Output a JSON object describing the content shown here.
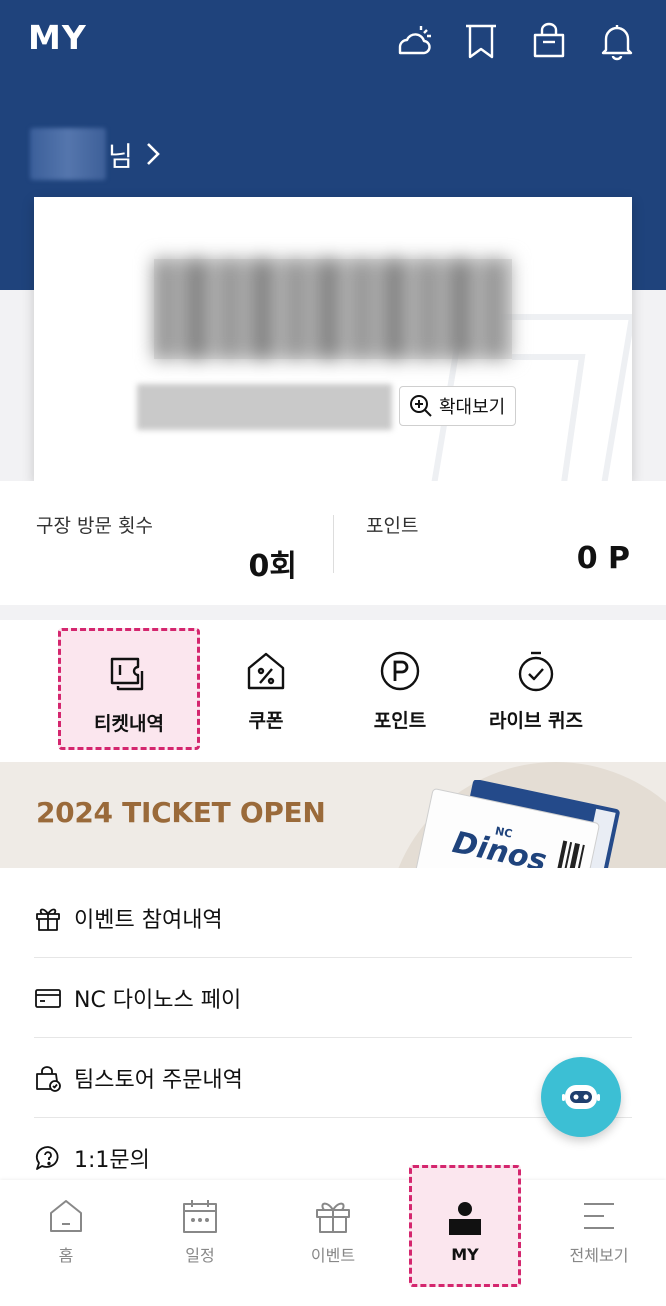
{
  "header": {
    "title": "MY",
    "icons": [
      "weather-icon",
      "bookmark-icon",
      "shop-bag-icon",
      "bell-icon"
    ]
  },
  "user": {
    "suffix": "님"
  },
  "card": {
    "zoom_label": "확대보기"
  },
  "stats": {
    "visits_label": "구장 방문 횟수",
    "visits_value": "0회",
    "points_label": "포인트",
    "points_value": "0 P"
  },
  "quick_menu": [
    {
      "label": "티켓내역",
      "icon": "ticket-icon"
    },
    {
      "label": "쿠폰",
      "icon": "coupon-icon"
    },
    {
      "label": "포인트",
      "icon": "point-icon"
    },
    {
      "label": "라이브 퀴즈",
      "icon": "quiz-timer-icon"
    }
  ],
  "banner": {
    "text": "2024 TICKET OPEN",
    "ticket_logo": "Dinos",
    "ticket_logo_top": "NC"
  },
  "list": [
    {
      "label": "이벤트 참여내역",
      "icon": "gift-icon"
    },
    {
      "label": "NC 다이노스 페이",
      "icon": "card-icon"
    },
    {
      "label": "팀스토어 주문내역",
      "icon": "store-bag-icon"
    },
    {
      "label": "1:1문의",
      "icon": "chat-question-icon"
    }
  ],
  "bottom_nav": [
    {
      "label": "홈",
      "icon": "home-icon"
    },
    {
      "label": "일정",
      "icon": "calendar-icon"
    },
    {
      "label": "이벤트",
      "icon": "gift-icon"
    },
    {
      "label": "MY",
      "icon": "person-icon"
    },
    {
      "label": "전체보기",
      "icon": "menu-icon"
    }
  ],
  "colors": {
    "header_bg": "#1f437c",
    "highlight": "#d4266e",
    "banner_text": "#9a6a3a",
    "chatbot": "#3cbfd4"
  }
}
